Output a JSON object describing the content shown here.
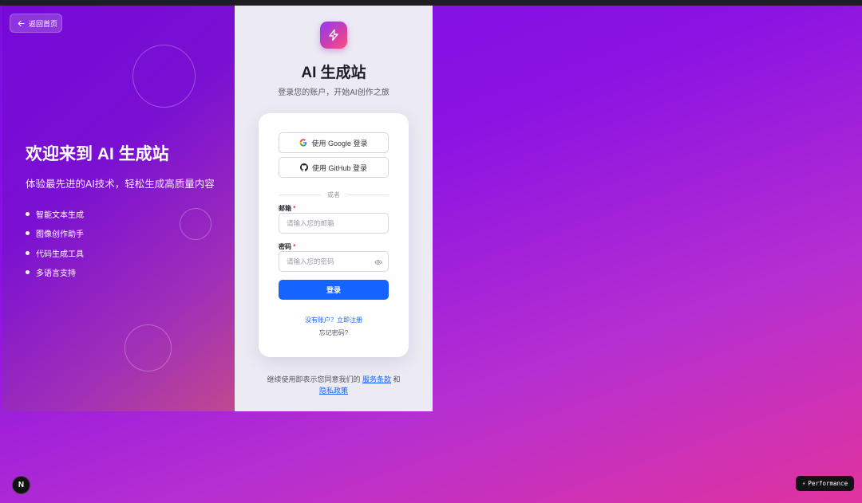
{
  "left": {
    "back_label": "返回首页",
    "title": "欢迎来到 AI 生成站",
    "subtitle": "体验最先进的AI技术，轻松生成高质量内容",
    "features": [
      "智能文本生成",
      "图像创作助手",
      "代码生成工具",
      "多语言支持"
    ]
  },
  "right": {
    "app_title": "AI 生成站",
    "app_subtitle": "登录您的账户，开始AI创作之旅",
    "google_label": "使用 Google 登录",
    "github_label": "使用 GitHub 登录",
    "divider": "或者",
    "email_label": "邮箱",
    "email_placeholder": "请输入您的邮箱",
    "password_label": "密码",
    "password_placeholder": "请输入您的密码",
    "required_mark": "*",
    "submit_label": "登录",
    "register_link": "没有账户？立即注册",
    "forgot_link": "忘记密码?",
    "terms_prefix": "继续使用即表示您同意我们的",
    "terms_link": "服务条款",
    "terms_and": "和",
    "privacy_link": "隐私政策"
  },
  "overlay": {
    "next_badge": "N",
    "performance_label": "Performance"
  },
  "colors": {
    "primary": "#1664ff",
    "background_start": "#7b0fe0",
    "background_end": "#e0339e"
  }
}
